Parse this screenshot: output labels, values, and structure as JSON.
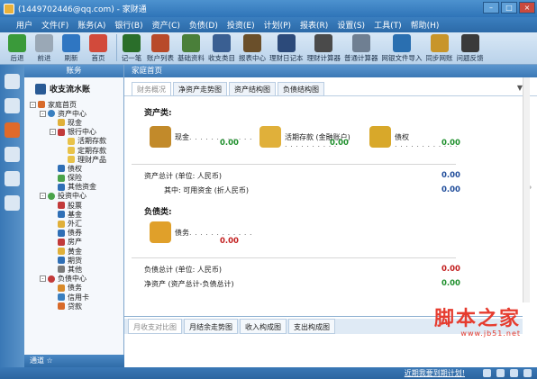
{
  "window": {
    "title": "(1449702446@qq.com) - 家财通"
  },
  "menu": [
    "用户",
    "文件(F)",
    "账务(A)",
    "银行(B)",
    "资产(C)",
    "负债(D)",
    "投资(E)",
    "计划(P)",
    "报表(R)",
    "设置(S)",
    "工具(T)",
    "帮助(H)"
  ],
  "toolbar": [
    {
      "label": "后退",
      "icon": "back-arrow-icon",
      "color": "#3a9a3a"
    },
    {
      "label": "前进",
      "icon": "forward-arrow-icon",
      "color": "#9aa8b6"
    },
    {
      "label": "刷新",
      "icon": "refresh-icon",
      "color": "#2f76c2"
    },
    {
      "label": "首页",
      "icon": "home-icon",
      "color": "#d24a3b"
    },
    {
      "label": "记一笔",
      "icon": "pen-icon",
      "color": "#2a6e2a"
    },
    {
      "label": "账户列表",
      "icon": "list-icon",
      "color": "#b84a2a"
    },
    {
      "label": "基础资料",
      "icon": "book-icon",
      "color": "#4a7f3a"
    },
    {
      "label": "收支类目",
      "icon": "category-icon",
      "color": "#3a5f92"
    },
    {
      "label": "报表中心",
      "icon": "report-icon",
      "color": "#6a4f2a"
    },
    {
      "label": "理财日记本",
      "icon": "diary-icon",
      "color": "#2c4a7a"
    },
    {
      "label": "理财计算器",
      "icon": "calculator-icon",
      "color": "#4a4a4a"
    },
    {
      "label": "普通计算器",
      "icon": "calc-icon",
      "color": "#6f7f92"
    },
    {
      "label": "网银文件导入",
      "icon": "import-icon",
      "color": "#2a6fb0"
    },
    {
      "label": "同步网账",
      "icon": "yen-icon",
      "color": "#c8952a"
    },
    {
      "label": "问题反馈",
      "icon": "feedback-icon",
      "color": "#3a3a3a"
    }
  ],
  "rail_icons": [
    {
      "icon": "ledger-icon",
      "color": "#dbe7f3"
    },
    {
      "icon": "window-icon",
      "color": "#dbe7f3"
    },
    {
      "icon": "star-icon",
      "color": "#e06a2a"
    },
    {
      "icon": "chart-icon",
      "color": "#dbe7f3"
    },
    {
      "icon": "settings-icon",
      "color": "#dbe7f3"
    },
    {
      "icon": "globe-icon",
      "color": "#dbe7f3"
    }
  ],
  "sidebar": {
    "header": "账务",
    "title": "收支流水账",
    "footer": "通道 ☆",
    "tree": [
      {
        "label": "家庭首页",
        "indent": 0,
        "toggle": "-",
        "color": "#d86a2a"
      },
      {
        "label": "资产中心",
        "indent": 1,
        "toggle": "-",
        "color": "#3a7fbf",
        "round": true
      },
      {
        "label": "现金",
        "indent": 2,
        "toggle": "",
        "color": "#e0b03a"
      },
      {
        "label": "银行中心",
        "indent": 2,
        "toggle": "-",
        "color": "#c23a3a"
      },
      {
        "label": "活期存款",
        "indent": 3,
        "toggle": "",
        "color": "#e8c24a"
      },
      {
        "label": "定期存款",
        "indent": 3,
        "toggle": "",
        "color": "#e8c24a"
      },
      {
        "label": "理财产品",
        "indent": 3,
        "toggle": "",
        "color": "#e8c24a"
      },
      {
        "label": "债权",
        "indent": 2,
        "toggle": "",
        "color": "#2f6fb6"
      },
      {
        "label": "保险",
        "indent": 2,
        "toggle": "",
        "color": "#4aa34a"
      },
      {
        "label": "其他资金",
        "indent": 2,
        "toggle": "",
        "color": "#2f6fb6"
      },
      {
        "label": "投资中心",
        "indent": 1,
        "toggle": "-",
        "color": "#4aa34a",
        "round": true
      },
      {
        "label": "股票",
        "indent": 2,
        "toggle": "",
        "color": "#c23a3a"
      },
      {
        "label": "基金",
        "indent": 2,
        "toggle": "",
        "color": "#2f6fb6"
      },
      {
        "label": "外汇",
        "indent": 2,
        "toggle": "",
        "color": "#e0b03a"
      },
      {
        "label": "债券",
        "indent": 2,
        "toggle": "",
        "color": "#2f6fb6"
      },
      {
        "label": "房产",
        "indent": 2,
        "toggle": "",
        "color": "#c23a3a"
      },
      {
        "label": "黄金",
        "indent": 2,
        "toggle": "",
        "color": "#e0b03a"
      },
      {
        "label": "期货",
        "indent": 2,
        "toggle": "",
        "color": "#2f6fb6"
      },
      {
        "label": "其他",
        "indent": 2,
        "toggle": "",
        "color": "#7a7a7a"
      },
      {
        "label": "负债中心",
        "indent": 1,
        "toggle": "-",
        "color": "#c23a3a",
        "round": true
      },
      {
        "label": "债务",
        "indent": 2,
        "toggle": "",
        "color": "#d88a2a"
      },
      {
        "label": "信用卡",
        "indent": 2,
        "toggle": "",
        "color": "#3a7fbf"
      },
      {
        "label": "贷款",
        "indent": 2,
        "toggle": "",
        "color": "#d86a2a"
      }
    ]
  },
  "main": {
    "header": "家庭首页",
    "tabs": [
      "财务概况",
      "净资产走势图",
      "资产结构图",
      "负债结构图"
    ],
    "active_tab": 0,
    "assets_title": "资产类:",
    "assets": [
      {
        "label": "现金",
        "value": "0.00",
        "icon": "coins-icon",
        "color": "#c28a2a"
      },
      {
        "label": "活期存款 (金融账户)",
        "value": "0.00",
        "icon": "bank-card-icon",
        "color": "#e0b03a"
      },
      {
        "label": "债权",
        "value": "0.00",
        "icon": "claim-icon",
        "color": "#d8a82a"
      }
    ],
    "total_assets_label": "资产总计 (单位: 人民币)",
    "total_assets_value": "0.00",
    "available_label": "其中: 可用资金 (折人民币)",
    "available_value": "0.00",
    "liab_title": "负债类:",
    "liabilities": [
      {
        "label": "债务",
        "value": "0.00",
        "icon": "debt-icon",
        "color": "#e0a02a"
      }
    ],
    "total_liab_label": "负债总计 (单位: 人民币)",
    "total_liab_value": "0.00",
    "net_label": "净资产 (资产总计-负债总计)",
    "net_value": "0.00",
    "bottom_tabs": [
      "月收支对比图",
      "月结余走势图",
      "收入构成图",
      "支出构成图"
    ],
    "bottom_active": 0
  },
  "status": {
    "link": "近期我要到期计划!"
  },
  "watermark": {
    "cn": "脚本之家",
    "url": "www.jb51.net"
  }
}
